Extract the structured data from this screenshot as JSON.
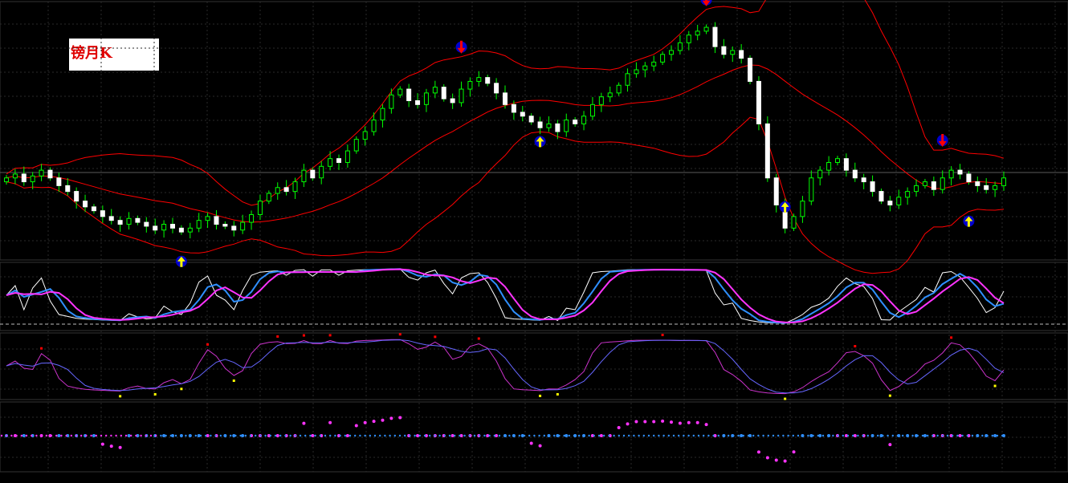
{
  "label": {
    "text": "镑月K"
  },
  "colors": {
    "background": "#000000",
    "bull": "#00ff00",
    "bear": "#ffffff",
    "bands": "#ff0000",
    "grid": "#2a2a2a",
    "signal_up": "#ffff00",
    "signal_down": "#ff0000",
    "stoch_main": "#ffffff",
    "stoch_fast": "#2f8fff",
    "stoch_slow": "#ff33ff",
    "osc_line": "#cc33cc",
    "osc_signal": "#6666ff",
    "state_low": "#ff33ff",
    "state_high": "#2f8fff"
  },
  "chart_data": {
    "type": "line",
    "grid": true,
    "panels": [
      {
        "name": "price",
        "type": "candlestick",
        "bands": 3,
        "signals": [
          "up-arrow",
          "down-arrow"
        ]
      },
      {
        "name": "stochastic",
        "series": 3
      },
      {
        "name": "oscillator",
        "series": 2,
        "markers": true
      },
      {
        "name": "state",
        "series": 1,
        "levels": 2
      }
    ],
    "closes": [
      1.62,
      1.64,
      1.6,
      1.63,
      1.66,
      1.62,
      1.58,
      1.55,
      1.5,
      1.47,
      1.45,
      1.42,
      1.4,
      1.38,
      1.41,
      1.39,
      1.37,
      1.35,
      1.38,
      1.36,
      1.34,
      1.36,
      1.4,
      1.42,
      1.38,
      1.37,
      1.35,
      1.39,
      1.43,
      1.5,
      1.54,
      1.57,
      1.55,
      1.6,
      1.66,
      1.62,
      1.68,
      1.72,
      1.7,
      1.76,
      1.82,
      1.86,
      1.92,
      1.98,
      2.05,
      2.08,
      2.02,
      2.0,
      2.06,
      2.09,
      2.03,
      2.01,
      2.08,
      2.12,
      2.14,
      2.11,
      2.06,
      2.0,
      1.96,
      1.94,
      1.91,
      1.88,
      1.9,
      1.86,
      1.92,
      1.9,
      1.94,
      2.0,
      2.04,
      2.06,
      2.1,
      2.16,
      2.18,
      2.2,
      2.22,
      2.26,
      2.28,
      2.32,
      2.36,
      2.38,
      2.4,
      2.3,
      2.26,
      2.28,
      2.24,
      2.12,
      1.9,
      1.62,
      1.48,
      1.36,
      1.42,
      1.5,
      1.62,
      1.66,
      1.7,
      1.72,
      1.66,
      1.62,
      1.6,
      1.55,
      1.5,
      1.48,
      1.52,
      1.55,
      1.58,
      1.6,
      1.56,
      1.62,
      1.66,
      1.64,
      1.6,
      1.58,
      1.56,
      1.58,
      1.62
    ]
  }
}
